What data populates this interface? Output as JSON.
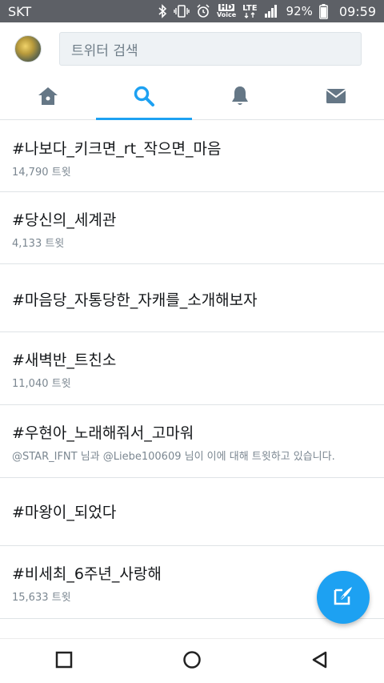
{
  "status_bar": {
    "carrier": "SKT",
    "hd_label": "HD",
    "voice_label": "Voice",
    "lte_label": "LTE",
    "battery": "92%",
    "time": "09:59"
  },
  "header": {
    "search_placeholder": "트위터 검색"
  },
  "tabs": [
    {
      "name": "home",
      "icon": "home-icon"
    },
    {
      "name": "search",
      "icon": "search-icon",
      "active": true
    },
    {
      "name": "notifications",
      "icon": "bell-icon"
    },
    {
      "name": "messages",
      "icon": "mail-icon"
    }
  ],
  "trends": [
    {
      "name": "#나보다_키크면_rt_작으면_마음",
      "meta": "14,790 트윗"
    },
    {
      "name": "#당신의_세계관",
      "meta": "4,133 트윗"
    },
    {
      "name": "#마음당_자통당한_자캐를_소개해보자",
      "meta": ""
    },
    {
      "name": "#새벽반_트친소",
      "meta": "11,040 트윗"
    },
    {
      "name": "#우현아_노래해줘서_고마워",
      "meta": "@STAR_IFNT 님과 @Liebe100609 님이 이에 대해 트윗하고 있습니다."
    },
    {
      "name": "#마왕이_되었다",
      "meta": ""
    },
    {
      "name": "#비세최_6주년_사랑해",
      "meta": "15,633 트윗"
    }
  ],
  "colors": {
    "accent": "#1da1f2",
    "status_bar": "#5d6066",
    "inactive_icon": "#657786"
  }
}
